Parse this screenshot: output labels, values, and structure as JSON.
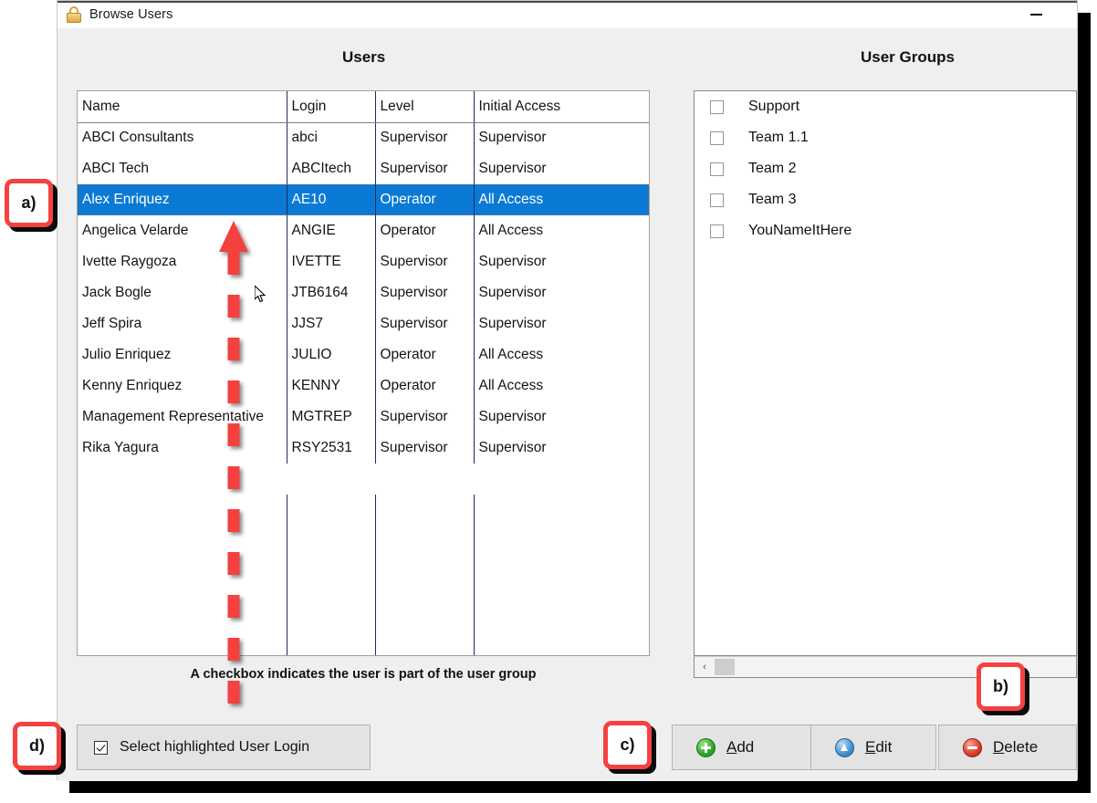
{
  "window": {
    "title": "Browse Users",
    "lock_icon": "lock-icon",
    "minimize_label": "—"
  },
  "headings": {
    "users": "Users",
    "user_groups": "User Groups"
  },
  "users_table": {
    "columns": [
      "Name",
      "Login",
      "Level",
      "Initial Access"
    ],
    "rows": [
      {
        "name": "ABCI Consultants",
        "login": "abci",
        "level": "Supervisor",
        "initial_access": "Supervisor",
        "selected": false
      },
      {
        "name": "ABCI Tech",
        "login": "ABCItech",
        "level": "Supervisor",
        "initial_access": "Supervisor",
        "selected": false
      },
      {
        "name": "Alex Enriquez",
        "login": "AE10",
        "level": "Operator",
        "initial_access": "All Access",
        "selected": true
      },
      {
        "name": "Angelica Velarde",
        "login": "ANGIE",
        "level": "Operator",
        "initial_access": "All Access",
        "selected": false
      },
      {
        "name": "Ivette Raygoza",
        "login": "IVETTE",
        "level": "Supervisor",
        "initial_access": "Supervisor",
        "selected": false
      },
      {
        "name": "Jack Bogle",
        "login": "JTB6164",
        "level": "Supervisor",
        "initial_access": "Supervisor",
        "selected": false
      },
      {
        "name": "Jeff Spira",
        "login": "JJS7",
        "level": "Supervisor",
        "initial_access": "Supervisor",
        "selected": false
      },
      {
        "name": "Julio Enriquez",
        "login": "JULIO",
        "level": "Operator",
        "initial_access": "All Access",
        "selected": false
      },
      {
        "name": "Kenny Enriquez",
        "login": "KENNY",
        "level": "Operator",
        "initial_access": "All Access",
        "selected": false
      },
      {
        "name": "Management Representative",
        "login": "MGTREP",
        "level": "Supervisor",
        "initial_access": "Supervisor",
        "selected": false
      },
      {
        "name": "Rika Yagura",
        "login": "RSY2531",
        "level": "Supervisor",
        "initial_access": "Supervisor",
        "selected": false
      }
    ],
    "note": "A checkbox indicates the user is part of the user group"
  },
  "user_groups": {
    "items": [
      {
        "label": "Support",
        "checked": false
      },
      {
        "label": "Team 1.1",
        "checked": false
      },
      {
        "label": "Team 2",
        "checked": false
      },
      {
        "label": "Team 3",
        "checked": false
      },
      {
        "label": "YouNameItHere",
        "checked": false
      }
    ],
    "scrollbar": {
      "left_arrow": "‹"
    }
  },
  "select_option": {
    "label": "Select highlighted User Login",
    "checked": true
  },
  "buttons": {
    "add": {
      "prefix": "",
      "accel": "A",
      "rest": "dd",
      "icon": "plus-circle-icon"
    },
    "edit": {
      "prefix": "",
      "accel": "E",
      "rest": "dit",
      "icon": "triangle-circle-icon"
    },
    "delete": {
      "prefix": "",
      "accel": "D",
      "rest": "elete",
      "icon": "minus-circle-icon"
    }
  },
  "callouts": {
    "a": "a)",
    "b": "b)",
    "c": "c)",
    "d": "d)"
  },
  "colors": {
    "selection_blue": "#0a7ad4",
    "callout_red": "#f5413f",
    "arrow_red": "#f5413f",
    "panel_bg": "#efefef",
    "button_bg": "#e3e3e3"
  }
}
